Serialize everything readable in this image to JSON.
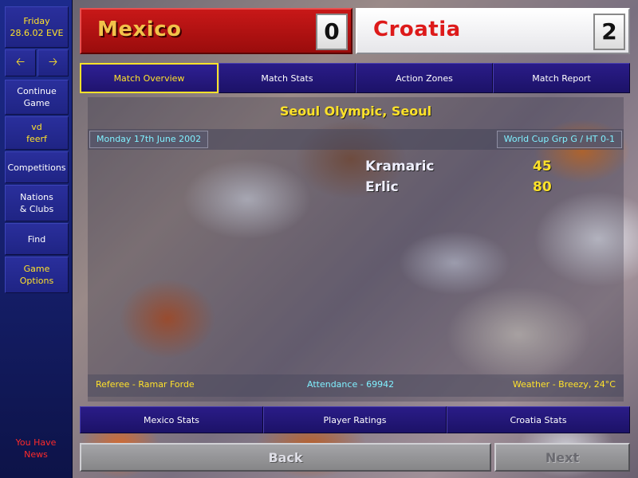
{
  "sidebar": {
    "day": "Friday",
    "date": "28.6.02 EVE",
    "back_arrow_icon": "arrow-left-icon",
    "forward_arrow_icon": "arrow-right-icon",
    "continue_line1": "Continue",
    "continue_line2": "Game",
    "manager_line1": "vd",
    "manager_line2": "feerf",
    "competitions": "Competitions",
    "nations_line1": "Nations",
    "nations_line2": "& Clubs",
    "find": "Find",
    "options_line1": "Game",
    "options_line2": "Options",
    "news_line1": "You Have",
    "news_line2": "News"
  },
  "scoreboard": {
    "home_team": "Mexico",
    "home_score": "0",
    "away_team": "Croatia",
    "away_score": "2"
  },
  "tabs": [
    {
      "label": "Match Overview",
      "active": true
    },
    {
      "label": "Match Stats",
      "active": false
    },
    {
      "label": "Action Zones",
      "active": false
    },
    {
      "label": "Match Report",
      "active": false
    }
  ],
  "match": {
    "venue": "Seoul Olympic, Seoul",
    "date": "Monday 17th June 2002",
    "competition": "World Cup Grp G / HT 0-1",
    "goals": [
      {
        "player": "Kramaric",
        "minute": "45"
      },
      {
        "player": "Erlic",
        "minute": "80"
      }
    ],
    "referee": "Referee - Ramar Forde",
    "attendance": "Attendance - 69942",
    "weather": "Weather - Breezy, 24°C"
  },
  "bottom_tabs": {
    "home_stats": "Mexico Stats",
    "player_ratings": "Player Ratings",
    "away_stats": "Croatia Stats"
  },
  "nav": {
    "back": "Back",
    "next": "Next"
  },
  "colors": {
    "sidebar_blue": "#1c2a8c",
    "highlight_yellow": "#ffe22a",
    "home_red": "#c81818",
    "away_name_red": "#dd1a1a",
    "info_cyan": "#80f0ff",
    "news_red": "#ff2a2a"
  }
}
